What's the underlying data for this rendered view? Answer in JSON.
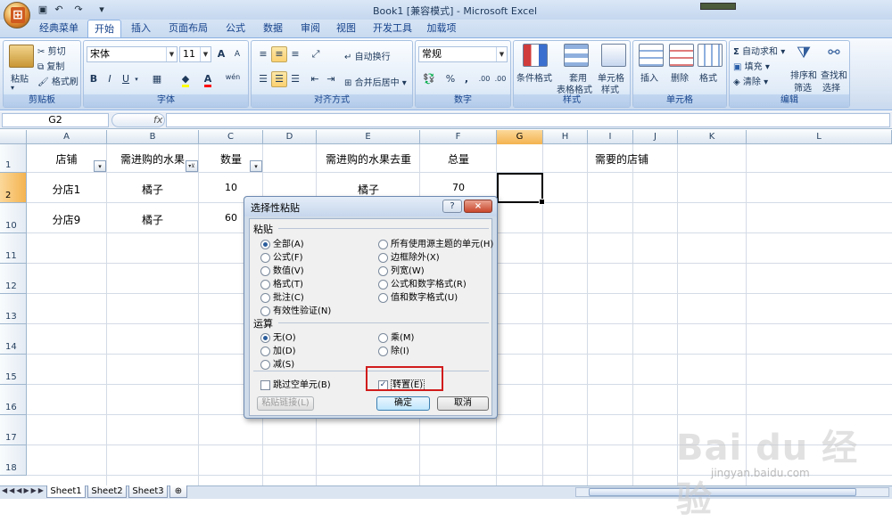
{
  "window": {
    "title": "Book1  [兼容模式] - Microsoft Excel"
  },
  "ribbon": {
    "tabs": [
      {
        "label": "经典菜单",
        "active": false
      },
      {
        "label": "开始",
        "active": true
      },
      {
        "label": "插入",
        "active": false
      },
      {
        "label": "页面布局",
        "active": false
      },
      {
        "label": "公式",
        "active": false
      },
      {
        "label": "数据",
        "active": false
      },
      {
        "label": "审阅",
        "active": false
      },
      {
        "label": "视图",
        "active": false
      },
      {
        "label": "开发工具",
        "active": false
      },
      {
        "label": "加载项",
        "active": false
      }
    ],
    "clipboard": {
      "label": "剪贴板",
      "paste": "粘贴",
      "cut": "剪切",
      "copy": "复制",
      "format_painter": "格式刷"
    },
    "font": {
      "label": "字体",
      "name": "宋体",
      "size": "11",
      "bold": "B",
      "italic": "I",
      "underline": "U",
      "grow": "A",
      "shrink": "A",
      "phonetic": "wén"
    },
    "alignment": {
      "label": "对齐方式",
      "wrap": "自动换行",
      "merge": "合并后居中"
    },
    "number": {
      "label": "数字",
      "format": "常规",
      "percent": "%",
      "comma": ",",
      "inc_dec": ".00",
      "dec_dec": ".00"
    },
    "styles": {
      "label": "样式",
      "cond_format": "条件格式",
      "table_format_1": "套用",
      "table_format_2": "表格格式",
      "cell_style_1": "单元格",
      "cell_style_2": "样式"
    },
    "cells": {
      "label": "单元格",
      "insert": "插入",
      "delete": "删除",
      "format": "格式"
    },
    "editing": {
      "label": "编辑",
      "autosum": "自动求和",
      "fill": "填充",
      "clear": "清除",
      "sort_1": "排序和",
      "sort_2": "筛选",
      "find_1": "查找和",
      "find_2": "选择"
    }
  },
  "formula_bar": {
    "name_box": "G2",
    "fx": "fx",
    "value": ""
  },
  "grid": {
    "columns": [
      "A",
      "B",
      "C",
      "D",
      "E",
      "F",
      "G",
      "H",
      "I",
      "J",
      "K",
      "L"
    ],
    "selected_column": "G",
    "rows": [
      "1",
      "2",
      "10",
      "11",
      "12",
      "13",
      "14",
      "15",
      "16",
      "17",
      "18"
    ],
    "selected_row": "2",
    "cells": {
      "A1": "店铺",
      "B1": "需进购的水果",
      "C1": "数量",
      "E1": "需进购的水果去重",
      "F1": "总量",
      "G1": "需要的店铺",
      "A2": "分店1",
      "B2": "橘子",
      "C2": "10",
      "E2": "橘子",
      "F2": "70",
      "A10": "分店9",
      "B10": "橘子",
      "C10": "60"
    },
    "filter_glyph": "▾",
    "filter_active_glyph": "▾⊻"
  },
  "sheets": [
    {
      "label": "Sheet1",
      "active": true
    },
    {
      "label": "Sheet2",
      "active": false
    },
    {
      "label": "Sheet3",
      "active": false
    }
  ],
  "dialog": {
    "title": "选择性粘贴",
    "help": "?",
    "close": "×",
    "paste_section": "粘贴",
    "paste_options": [
      {
        "label": "全部(A)",
        "checked": true
      },
      {
        "label": "公式(F)",
        "checked": false
      },
      {
        "label": "数值(V)",
        "checked": false
      },
      {
        "label": "格式(T)",
        "checked": false
      },
      {
        "label": "批注(C)",
        "checked": false
      },
      {
        "label": "有效性验证(N)",
        "checked": false
      },
      {
        "label": "所有使用源主题的单元(H)",
        "checked": false
      },
      {
        "label": "边框除外(X)",
        "checked": false
      },
      {
        "label": "列宽(W)",
        "checked": false
      },
      {
        "label": "公式和数字格式(R)",
        "checked": false
      },
      {
        "label": "值和数字格式(U)",
        "checked": false
      }
    ],
    "operation_section": "运算",
    "operation_options": [
      {
        "label": "无(O)",
        "checked": true
      },
      {
        "label": "加(D)",
        "checked": false
      },
      {
        "label": "减(S)",
        "checked": false
      },
      {
        "label": "乘(M)",
        "checked": false
      },
      {
        "label": "除(I)",
        "checked": false
      }
    ],
    "skip_blanks": "跳过空单元(B)",
    "transpose": "转置(E)",
    "paste_link": "粘贴链接(L)",
    "ok": "确定",
    "cancel": "取消"
  },
  "watermark": {
    "logo": "Bai du 经验",
    "url": "jingyan.baidu.com"
  }
}
